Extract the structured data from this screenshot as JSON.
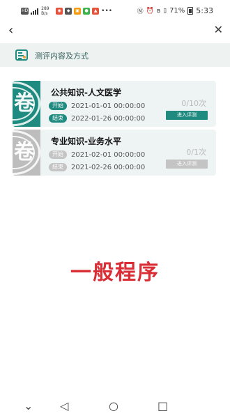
{
  "status_bar": {
    "network_speed": "289 B/s",
    "battery": "71%",
    "time": "5:33"
  },
  "nav": {
    "back_icon": "‹",
    "close_icon": "✕"
  },
  "section": {
    "title": "测评内容及方式",
    "icon": "list-check-icon"
  },
  "cards": [
    {
      "seal_char": "卷",
      "title": "公共知识-人文医学",
      "start_label": "开始",
      "start_time": "2021-01-01 00:00:00",
      "end_label": "结束",
      "end_time": "2022-01-26 00:00:00",
      "count": "0/10次",
      "button": "进入评测",
      "active": true
    },
    {
      "seal_char": "卷",
      "title": "专业知识-业务水平",
      "start_label": "开始",
      "start_time": "2021-02-01 00:00:00",
      "end_label": "结束",
      "end_time": "2021-02-26 00:00:00",
      "count": "0/1次",
      "button": "进入评测",
      "active": false
    }
  ],
  "overlay": {
    "text": "一般程序"
  },
  "colors": {
    "accent": "#1f8a80",
    "inactive": "#bdbdbd",
    "overlay_red": "#d92e36"
  },
  "system_nav": {
    "down_icon": "chevron-down-icon",
    "back_icon": "triangle-back-icon",
    "home_icon": "circle-home-icon",
    "recents_icon": "square-recents-icon"
  }
}
